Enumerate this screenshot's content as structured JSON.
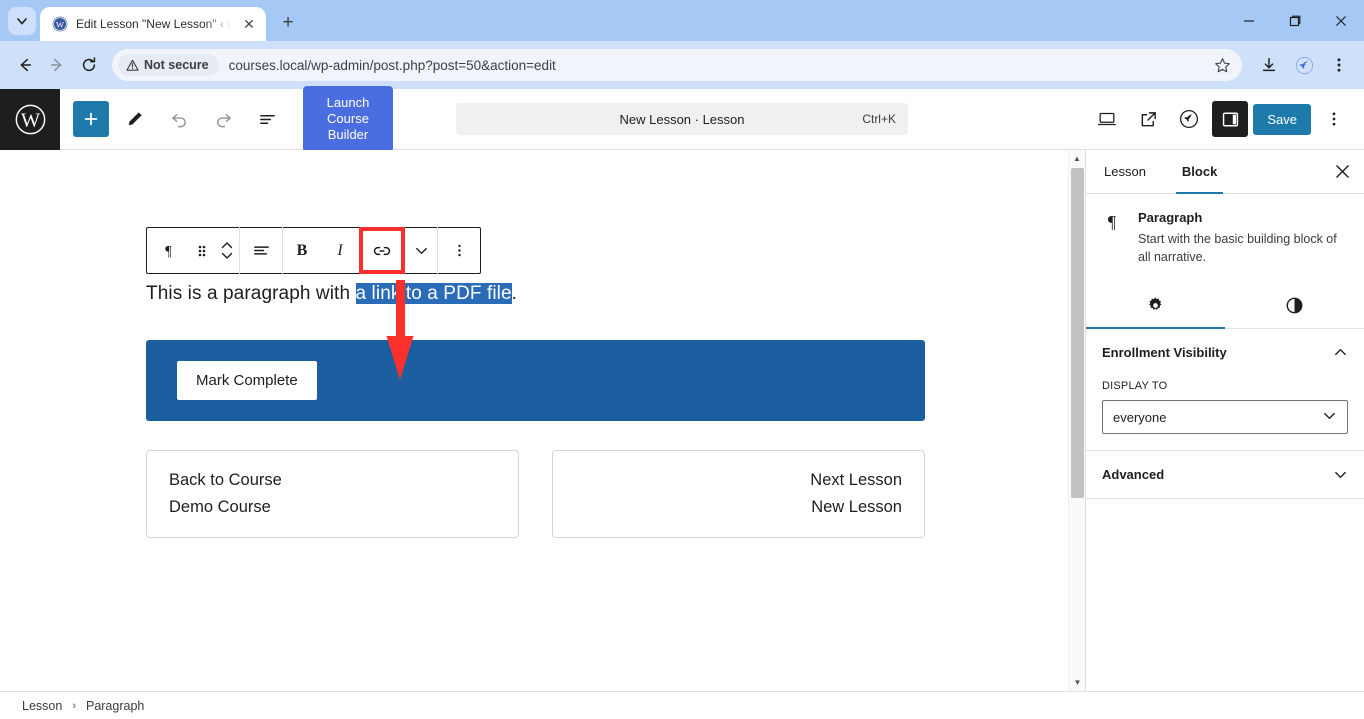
{
  "browser": {
    "tab": {
      "title": "Edit Lesson \"New Lesson\" ‹ cou",
      "favicon_name": "wordpress-favicon",
      "close_label": "✕"
    },
    "new_tab_label": "+",
    "window_controls": {
      "minimize": "—",
      "maximize": "▢",
      "close": "✕"
    },
    "nav": {
      "back": "←",
      "forward": "→",
      "reload": "⟳"
    },
    "omnibox": {
      "security_label": "Not secure",
      "url": "courses.local/wp-admin/post.php?post=50&action=edit"
    },
    "right_icons": [
      "download-icon",
      "rocket-extension-icon",
      "chrome-menu-icon"
    ]
  },
  "editor": {
    "logo_name": "wordpress-logo",
    "tools": {
      "add_block": "+",
      "edit_tool": "pencil-icon",
      "undo": "undo-icon",
      "redo": "redo-icon",
      "list_view": "list-view-icon"
    },
    "launch_button_label": "Launch Course Builder",
    "document_bar": {
      "title": "New Lesson · Lesson",
      "shortcut": "Ctrl+K"
    },
    "right_tools": {
      "preview": "desktop-preview-icon",
      "view_post": "external-link-icon",
      "jetpack": "jetpack-icon",
      "settings_toggle": "settings-sidebar-icon",
      "save_label": "Save",
      "more_options": "three-dot-menu-icon"
    }
  },
  "block_toolbar": {
    "block_type_icon": "paragraph-icon",
    "drag_handle": "drag-handle-icon",
    "move_up": "chevron-up-icon",
    "move_down": "chevron-down-icon",
    "align": "align-text-icon",
    "bold": "B",
    "italic": "I",
    "link": "link-icon",
    "more_formats": "chevron-down-icon",
    "options": "three-dot-icon",
    "highlighted_control": "link"
  },
  "content": {
    "paragraph": {
      "before": "This is a paragraph with ",
      "selected": "a link to a PDF file",
      "after": "."
    },
    "mark_complete_label": "Mark Complete",
    "nav_prev": {
      "line1": "Back to Course",
      "line2": "Demo Course"
    },
    "nav_next": {
      "line1": "Next Lesson",
      "line2": "New Lesson"
    }
  },
  "sidebar": {
    "tabs": [
      {
        "label": "Lesson",
        "active": false
      },
      {
        "label": "Block",
        "active": true
      }
    ],
    "close_label": "✕",
    "block_info": {
      "icon": "paragraph-icon",
      "title": "Paragraph",
      "description": "Start with the basic building block of all narrative."
    },
    "icon_tabs": [
      {
        "name": "settings-gear-icon",
        "active": true
      },
      {
        "name": "styles-contrast-icon",
        "active": false
      }
    ],
    "panels": [
      {
        "title": "Enrollment Visibility",
        "expanded": true,
        "field_label": "DISPLAY TO",
        "field_value": "everyone"
      },
      {
        "title": "Advanced",
        "expanded": false
      }
    ]
  },
  "footer": {
    "breadcrumb": [
      "Lesson",
      "Paragraph"
    ],
    "separator": "›"
  },
  "annotation": {
    "arrow_color": "#f9302b",
    "highlight_color": "#f9302b",
    "points_to": "link-icon"
  },
  "colors": {
    "wp_blue": "#1e7aab",
    "launch_blue": "#4a6ee0",
    "panel_blue": "#1b5fa0",
    "selection_blue": "#2b6cb8",
    "accent_teal": "#1e7aab"
  }
}
